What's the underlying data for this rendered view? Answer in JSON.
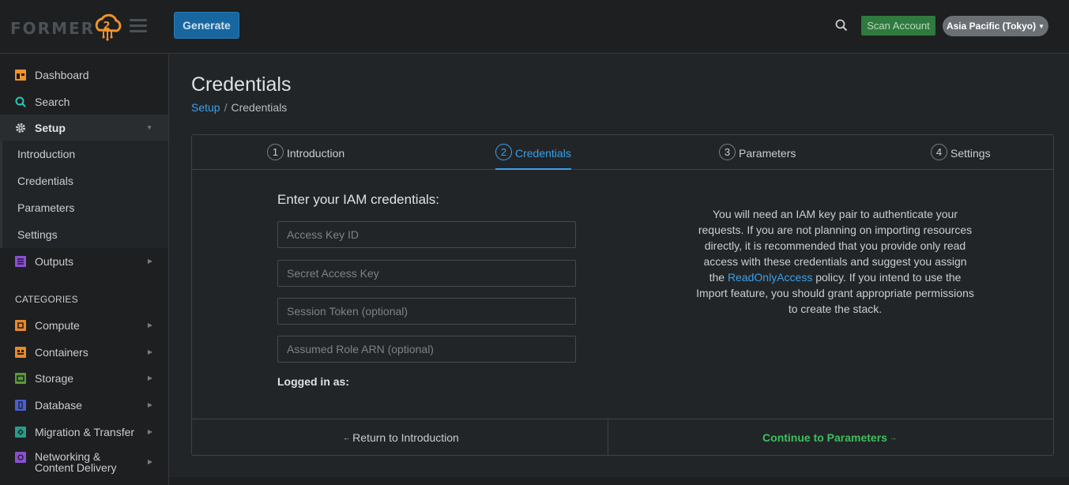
{
  "header": {
    "logo_text": "FORMER",
    "logo_mark": "2",
    "generate_label": "Generate",
    "scan_label": "Scan Account",
    "region_label": "Asia Pacific (Tokyo)",
    "search_icon": "search-icon"
  },
  "sidebar": {
    "items": [
      {
        "label": "Dashboard",
        "icon": "dashboard-icon",
        "color": "#f0932b"
      },
      {
        "label": "Search",
        "icon": "search-icon",
        "color": "#2ec4b6"
      },
      {
        "label": "Setup",
        "icon": "gear-icon",
        "color": "#c9cdd1"
      }
    ],
    "setup_sub": [
      "Introduction",
      "Credentials",
      "Parameters",
      "Settings"
    ],
    "outputs_label": "Outputs",
    "categories_header": "CATEGORIES",
    "categories": [
      {
        "label": "Compute",
        "color": "#e8892b"
      },
      {
        "label": "Containers",
        "color": "#e8892b"
      },
      {
        "label": "Storage",
        "color": "#5a9a3a"
      },
      {
        "label": "Database",
        "color": "#4b5fd1"
      },
      {
        "label": "Migration & Transfer",
        "color": "#2b9a8a"
      },
      {
        "label": "Networking & Content Delivery",
        "color": "#8b4fd1"
      }
    ]
  },
  "main": {
    "title": "Credentials",
    "breadcrumb": {
      "link": "Setup",
      "sep": "/",
      "current": "Credentials"
    },
    "tabs": [
      {
        "num": "1",
        "label": "Introduction"
      },
      {
        "num": "2",
        "label": "Credentials"
      },
      {
        "num": "3",
        "label": "Parameters"
      },
      {
        "num": "4",
        "label": "Settings"
      }
    ],
    "form": {
      "title": "Enter your IAM credentials:",
      "access_key_placeholder": "Access Key ID",
      "secret_key_placeholder": "Secret Access Key",
      "session_token_placeholder": "Session Token (optional)",
      "role_arn_placeholder": "Assumed Role ARN (optional)",
      "logged_in_label": "Logged in as:"
    },
    "info": {
      "part1": "You will need an IAM key pair to authenticate your requests. If you are not planning on importing resources directly, it is recommended that you provide only read access with these credentials and suggest you assign the ",
      "link": "ReadOnlyAccess",
      "part2": " policy. If you intend to use the Import feature, you should grant appropriate permissions to create the stack."
    },
    "footer": {
      "back_label": "Return to Introduction",
      "next_label": "Continue to Parameters"
    }
  },
  "colors": {
    "accent": "#3aa0e8",
    "success": "#3fbf5e",
    "generate": "#1866a0",
    "scan": "#2f7a3e"
  }
}
